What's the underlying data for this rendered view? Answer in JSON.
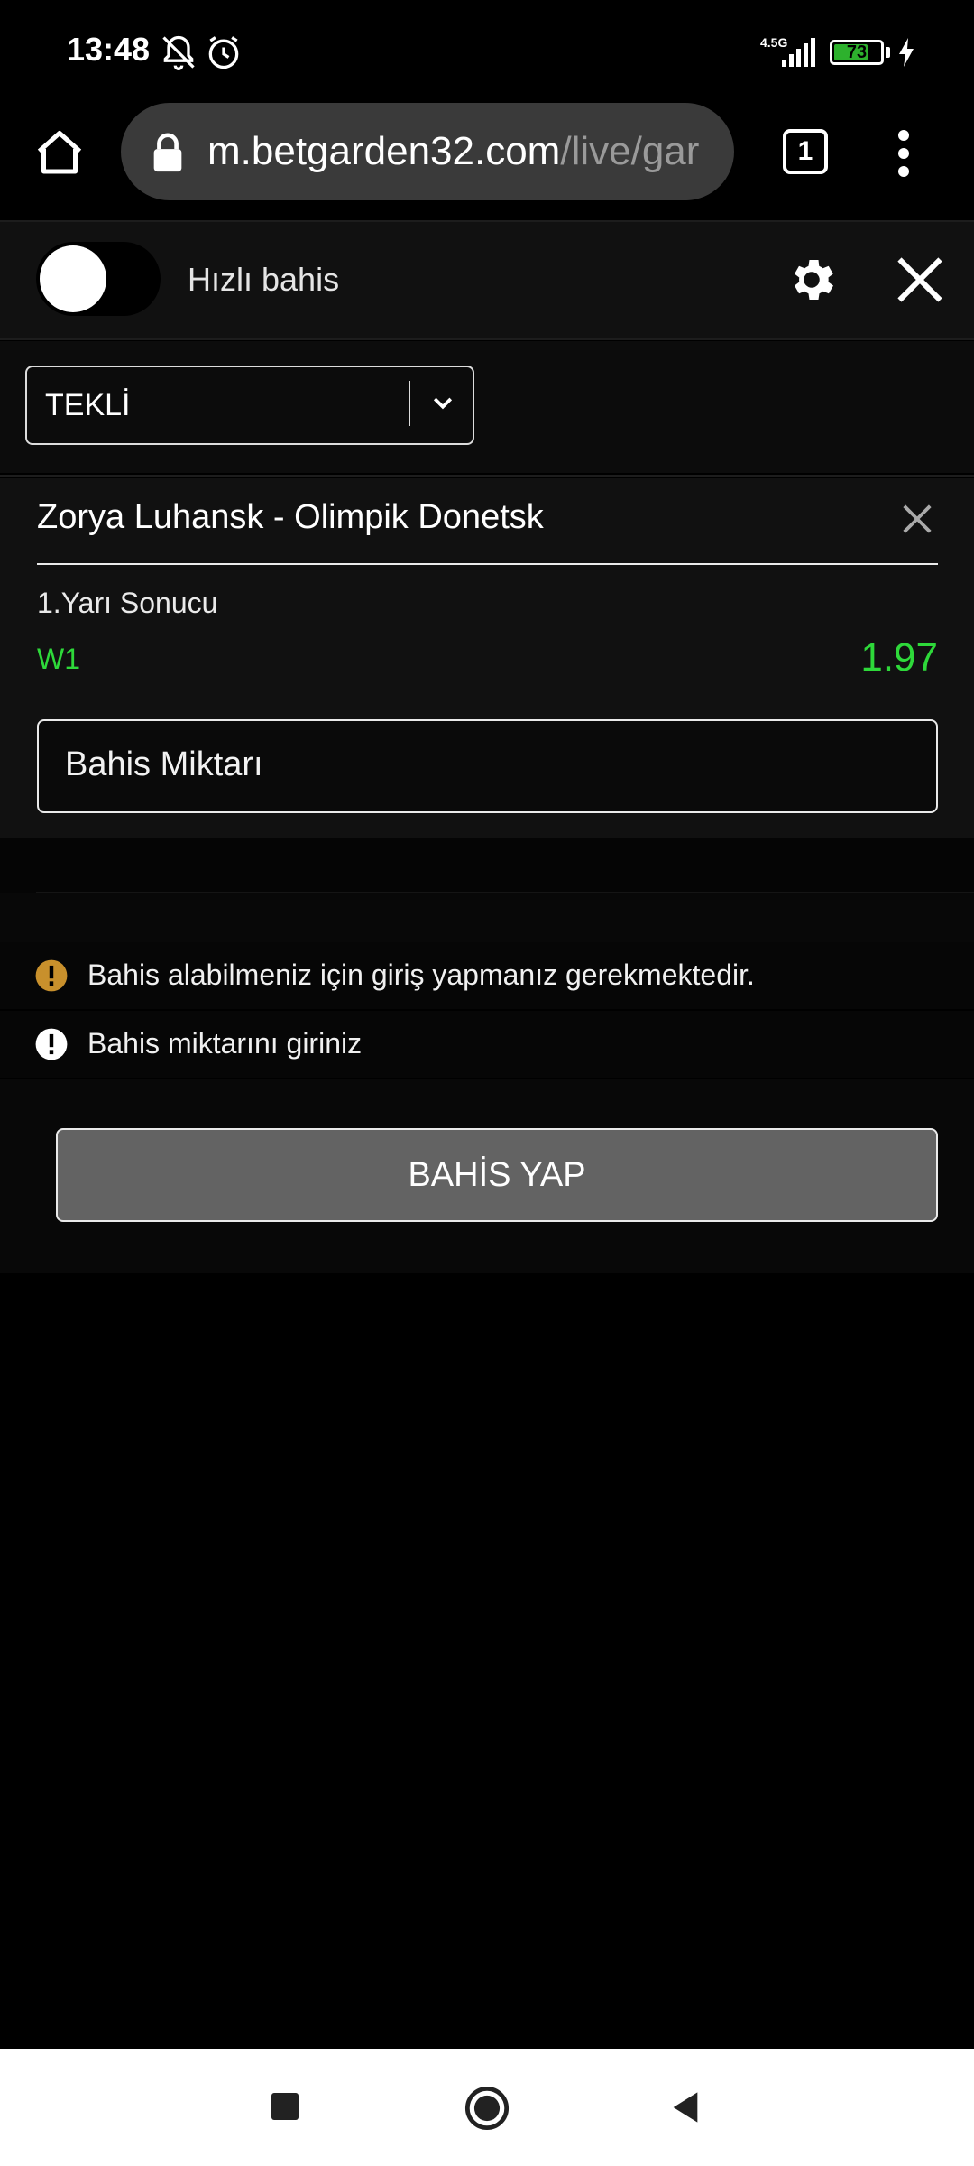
{
  "status_bar": {
    "time": "13:48",
    "network_label": "4.5G",
    "battery_percent": "73",
    "battery_level": 0.73,
    "icons": [
      "bell-off-icon",
      "alarm-icon",
      "signal-icon",
      "battery-icon",
      "charging-icon"
    ]
  },
  "browser": {
    "url_host": "m.betgarden32.com",
    "url_path": "/live/gar",
    "tab_count": "1",
    "icons": [
      "home-icon",
      "lock-icon",
      "tabs-icon",
      "more-vert-icon"
    ]
  },
  "quick_bet": {
    "label": "Hızlı bahis",
    "toggle_on": false
  },
  "bet_type": {
    "selected": "TEKLİ"
  },
  "bet": {
    "match": "Zorya Luhansk - Olimpik Donetsk",
    "market": "1.Yarı Sonucu",
    "pick": "W1",
    "odds": "1.97",
    "amount_placeholder": "Bahis Miktarı"
  },
  "messages": [
    {
      "text": "Bahis alabilmeniz için giriş yapmanız gerekmektedir.",
      "icon": "warning-icon",
      "color": "#c8902c"
    },
    {
      "text": "Bahis miktarını giriniz",
      "icon": "error-icon",
      "color": "#ffffff"
    }
  ],
  "actions": {
    "place_bet_label": "BAHİS YAP"
  },
  "colors": {
    "accent_green": "#2ed93a",
    "button_gray": "#636363"
  }
}
